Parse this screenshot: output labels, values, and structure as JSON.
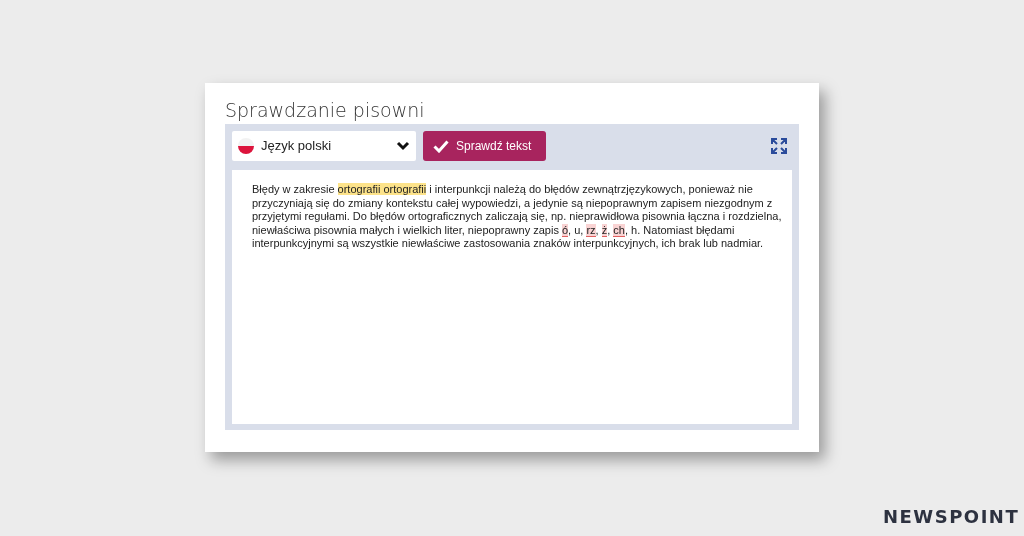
{
  "card": {
    "title": "Sprawdzanie pisowni"
  },
  "toolbar": {
    "language_select": {
      "value": "Język polski"
    },
    "check_button": {
      "label": "Sprawdź tekst"
    }
  },
  "editor": {
    "lines": [
      [
        {
          "kind": "plain",
          "text": "Błędy w zakresie "
        },
        {
          "kind": "duplicate",
          "text": "ortografii ortografii"
        },
        {
          "kind": "plain",
          "text": " i interpunkcji należą do błędów zewnątrzjęzykowych, ponieważ nie"
        }
      ],
      [
        {
          "kind": "plain",
          "text": "przyczyniają się do zmiany kontekstu całej wypowiedzi, a jedynie są niepoprawnym zapisem niezgodnym z"
        }
      ],
      [
        {
          "kind": "plain",
          "text": "przyjętymi regułami. Do błędów ortograficznych zaliczają się, np. nieprawidłowa pisownia łączna i rozdzielna,"
        }
      ],
      [
        {
          "kind": "plain",
          "text": "niewłaściwa pisownia małych i wielkich liter, niepoprawny zapis "
        },
        {
          "kind": "error",
          "text": "ó"
        },
        {
          "kind": "plain",
          "text": ", u, "
        },
        {
          "kind": "error",
          "text": "rz"
        },
        {
          "kind": "plain",
          "text": ", "
        },
        {
          "kind": "error",
          "text": "ż"
        },
        {
          "kind": "plain",
          "text": ", "
        },
        {
          "kind": "error",
          "text": "ch"
        },
        {
          "kind": "plain",
          "text": ", h. Natomiast błędami"
        }
      ],
      [
        {
          "kind": "plain",
          "text": "interpunkcyjnymi są wszystkie niewłaściwe zastosowania znaków interpunkcyjnych, ich brak lub nadmiar."
        }
      ]
    ]
  },
  "logo": {
    "text": "NEWSPOINT"
  }
}
